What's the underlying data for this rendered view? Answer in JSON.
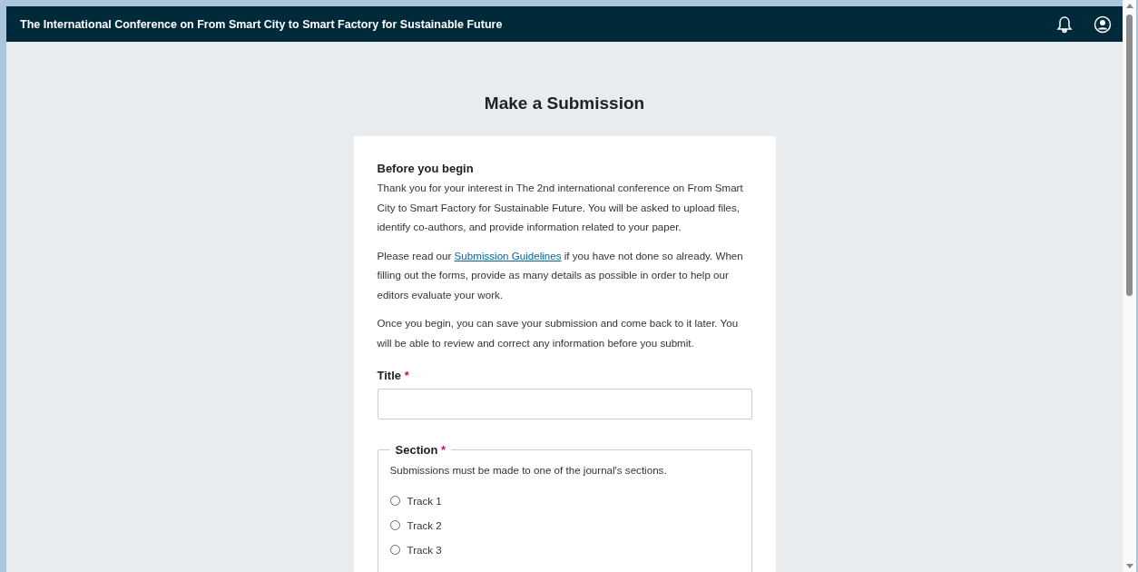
{
  "header": {
    "title": "The International Conference on From Smart City to Smart Factory for Sustainable Future"
  },
  "page_title": "Make a Submission",
  "intro": {
    "heading": "Before you begin",
    "paragraph_1": "Thank you for your interest in The 2nd international conference on From Smart City to Smart Factory for Sustainable Future. You will be asked to upload files, identify co-authors, and provide information related to your paper.",
    "paragraph_2_before": "Please read our",
    "paragraph_2_link": "Submission Guidelines",
    "paragraph_2_after": "if you have not done so already. When filling out the forms, provide as many details as possible in order to help our editors evaluate your work.",
    "paragraph_3": "Once you begin, you can save your submission and come back to it later. You will be able to review and correct any information before you submit."
  },
  "title_field": {
    "label": "Title",
    "required_mark": "*"
  },
  "section": {
    "legend": "Section",
    "required_mark": "*",
    "description": "Submissions must be made to one of the journal's sections.",
    "options": [
      {
        "label": "Track 1",
        "selected": false
      },
      {
        "label": "Track 2",
        "selected": false
      },
      {
        "label": "Track 3",
        "selected": false
      }
    ]
  }
}
